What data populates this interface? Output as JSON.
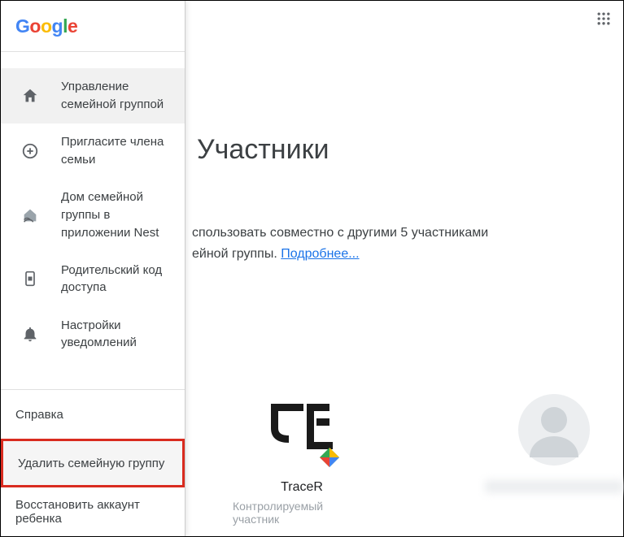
{
  "logo": {
    "g1": "G",
    "o1": "o",
    "o2": "o",
    "g2": "g",
    "l1": "l",
    "e1": "e"
  },
  "sidebar": {
    "items": [
      {
        "icon": "home",
        "label": "Управление семейной группой"
      },
      {
        "icon": "add-circle",
        "label": "Пригласите члена семьи"
      },
      {
        "icon": "nest-home",
        "label": "Дом семейной группы в приложении Nest"
      },
      {
        "icon": "phone-code",
        "label": "Родительский код доступа"
      },
      {
        "icon": "bell",
        "label": "Настройки уведомлений"
      }
    ]
  },
  "bottom": {
    "help": "Справка",
    "delete": "Удалить семейную группу",
    "restore": "Восстановить аккаунт ребенка"
  },
  "main": {
    "title": "Участники",
    "description_line1": "спользовать совместно с другими 5 участниками",
    "description_line2": "ейной группы. ",
    "link": "Подробнее..."
  },
  "members": [
    {
      "name": "TraceR",
      "role": "Контролируемый участник"
    }
  ]
}
